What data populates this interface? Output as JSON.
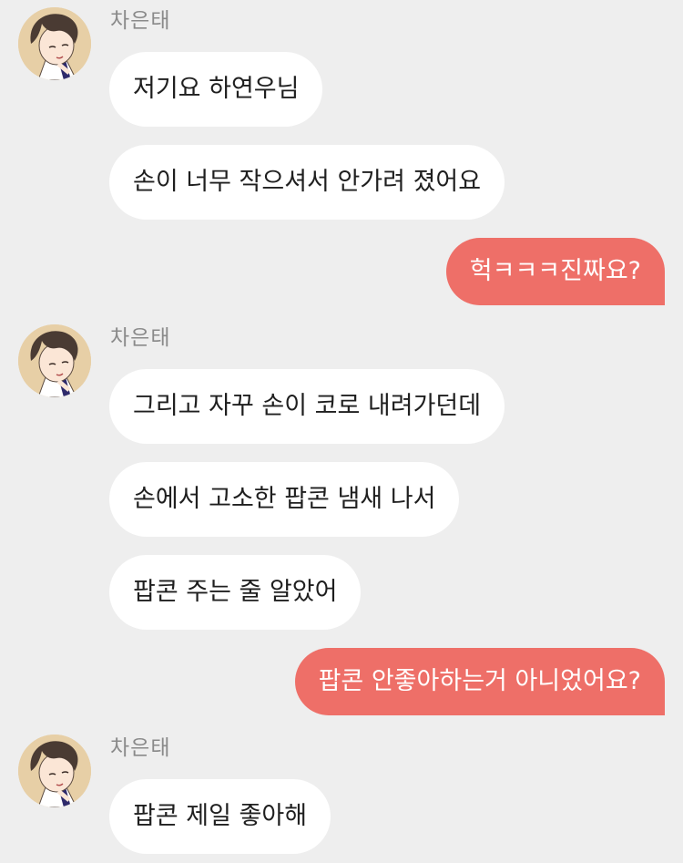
{
  "conversation": {
    "sender_name": "차은태",
    "groups": [
      {
        "avatar_icon": "character-avatar-icon",
        "messages": [
          {
            "text": "저기요 하연우님"
          },
          {
            "text": "손이 너무 작으셔서 안가려 졌어요"
          }
        ]
      },
      {
        "avatar_icon": "character-avatar-icon",
        "messages": [
          {
            "text": "그리고 자꾸 손이 코로 내려가던데"
          },
          {
            "text": "손에서 고소한 팝콘 냄새 나서"
          },
          {
            "text": "팝콘 주는 줄 알았어"
          }
        ]
      },
      {
        "avatar_icon": "character-avatar-icon",
        "messages": [
          {
            "text": "팝콘 제일 좋아해"
          }
        ]
      }
    ],
    "replies": [
      {
        "text": "헉ㅋㅋㅋ진짜요?"
      },
      {
        "text": "팝콘 안좋아하는거 아니었어요?"
      }
    ]
  },
  "colors": {
    "background": "#eeeeee",
    "incoming_bubble": "#ffffff",
    "outgoing_bubble": "#ee6f68",
    "sender_name": "#8a8a8a"
  }
}
